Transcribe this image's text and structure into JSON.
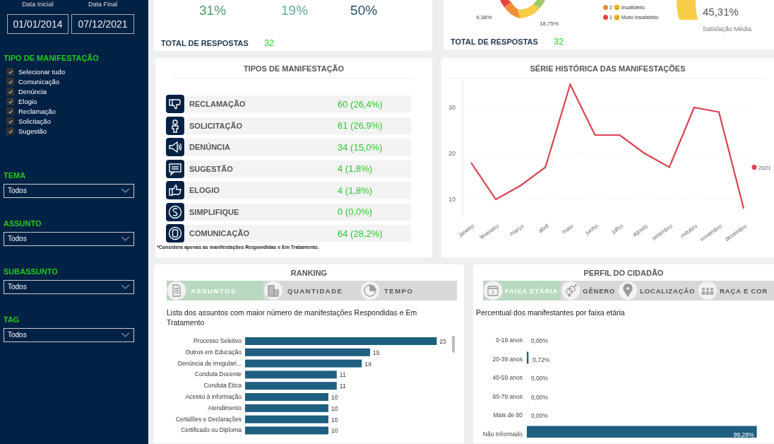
{
  "sidebar": {
    "date_filters": [
      {
        "label": "Data Inicial",
        "value": "01/01/2014"
      },
      {
        "label": "Data Final",
        "value": "07/12/2021"
      }
    ],
    "type_filter": {
      "title": "TIPO DE MANIFESTAÇÃO",
      "options": [
        {
          "label": "Selecionar tudo",
          "checked": true
        },
        {
          "label": "Comunicação",
          "checked": true
        },
        {
          "label": "Denúncia",
          "checked": true
        },
        {
          "label": "Elogio",
          "checked": true
        },
        {
          "label": "Reclamação",
          "checked": true
        },
        {
          "label": "Solicitação",
          "checked": true
        },
        {
          "label": "Sugestão",
          "checked": true
        }
      ]
    },
    "dropdowns": [
      {
        "title": "TEMA",
        "value": "Todos"
      },
      {
        "title": "ASSUNTO",
        "value": "Todos"
      },
      {
        "title": "SUBASSUNTO",
        "value": "Todos"
      },
      {
        "title": "TAG",
        "value": "Todos"
      }
    ]
  },
  "summary_card": {
    "percentages": [
      {
        "value": "31%",
        "color": "#4f9a6c"
      },
      {
        "value": "19%",
        "color": "#62aaa2"
      },
      {
        "value": "50%",
        "color": "#1e4f6e"
      }
    ],
    "total_label": "TOTAL DE RESPOSTAS",
    "total_value": "32"
  },
  "satisfaction_card": {
    "slice_labels": [
      "9,38%",
      "18,75%"
    ],
    "legend": [
      {
        "rank": "2",
        "label": "Insatisfeito",
        "color": "#f28c38"
      },
      {
        "rank": "1",
        "label": "Muito Insatisfeito",
        "color": "#e8423f"
      }
    ],
    "average": "45,31%",
    "average_label": "Satisfação Média",
    "total_label": "TOTAL DE RESPOSTAS",
    "total_value": "32"
  },
  "types_card": {
    "title": "TIPOS DE MANIFESTAÇÃO",
    "rows": [
      {
        "kind": "complaint",
        "label": "RECLAMAÇÃO",
        "value": "60 (26,4%)"
      },
      {
        "kind": "request",
        "label": "SOLICITAÇÃO",
        "value": "61 (26,9%)"
      },
      {
        "kind": "report",
        "label": "DENÚNCIA",
        "value": "34 (15,0%)"
      },
      {
        "kind": "suggestion",
        "label": "SUGESTÃO",
        "value": "4 (1,8%)"
      },
      {
        "kind": "praise",
        "label": "ELOGIO",
        "value": "4 (1,8%)"
      },
      {
        "kind": "simplify",
        "label": "SIMPLIFIQUE",
        "value": "0 (0,0%)"
      },
      {
        "kind": "communication",
        "label": "COMUNICAÇÃO",
        "value": "64 (28,2%)"
      }
    ],
    "footnote": "*Considera apenas as manifestações Respondidas e Em Tratamento."
  },
  "series_card": {
    "title": "SÉRIE HISTÓRICA DAS MANIFESTAÇÕES",
    "chart_data": {
      "type": "line",
      "categories": [
        "janeiro",
        "fevereiro",
        "março",
        "abril",
        "maio",
        "junho",
        "julho",
        "agosto",
        "setembro",
        "outubro",
        "novembro",
        "dezembro"
      ],
      "series": [
        {
          "name": "2021",
          "color": "#d9434e",
          "values": [
            18,
            10,
            13,
            17,
            35,
            24,
            24,
            20,
            17,
            30,
            29,
            8
          ]
        }
      ],
      "grid": true,
      "ylim": [
        6,
        36
      ],
      "yticks": [
        10,
        20,
        30
      ]
    }
  },
  "ranking_card": {
    "title": "RANKING",
    "tabs": [
      {
        "kind": "document",
        "label": "ASSUNTOS",
        "selected": true
      },
      {
        "kind": "building",
        "label": "QUANTIDADE",
        "selected": false
      },
      {
        "kind": "clock",
        "label": "TEMPO",
        "selected": false
      }
    ],
    "subtitle": "Lista dos assuntos com maior número de manifestações Respondidas e Em Tratamento",
    "chart_data": {
      "type": "bar",
      "orientation": "horizontal",
      "categories": [
        "Processo Seletivo",
        "Outros em Educação",
        "Denúncia de irregulari...",
        "Conduta Docente",
        "Conduta Ética",
        "Acesso à informação",
        "Atendimento",
        "Certidões e Declarações",
        "Certificado ou Diploma"
      ],
      "values": [
        23,
        15,
        14,
        11,
        11,
        10,
        10,
        10,
        10
      ],
      "data_labels": true
    }
  },
  "profile_card": {
    "title": "PERFIL DO CIDADÃO",
    "tabs": [
      {
        "kind": "calendar",
        "label": "FAIXA ETÁRIA",
        "selected": true
      },
      {
        "kind": "gender",
        "label": "GÊNERO",
        "selected": false
      },
      {
        "kind": "pin",
        "label": "LOCALIZAÇÃO",
        "selected": false
      },
      {
        "kind": "people",
        "label": "RAÇA E COR",
        "selected": false
      }
    ],
    "subtitle": "Percentual dos manifestantes por faixa etária",
    "chart_data": {
      "type": "bar",
      "orientation": "horizontal",
      "categories": [
        "0-19 anos",
        "20-39 anos",
        "40-59 anos",
        "60-79 anos",
        "Mais de 80",
        "Não Informado"
      ],
      "values": [
        0,
        0.72,
        0,
        0,
        0,
        99.28
      ],
      "value_labels": [
        "0,00%",
        "0,72%",
        "0,00%",
        "0,00%",
        "0,00%",
        "99,28%"
      ]
    }
  }
}
